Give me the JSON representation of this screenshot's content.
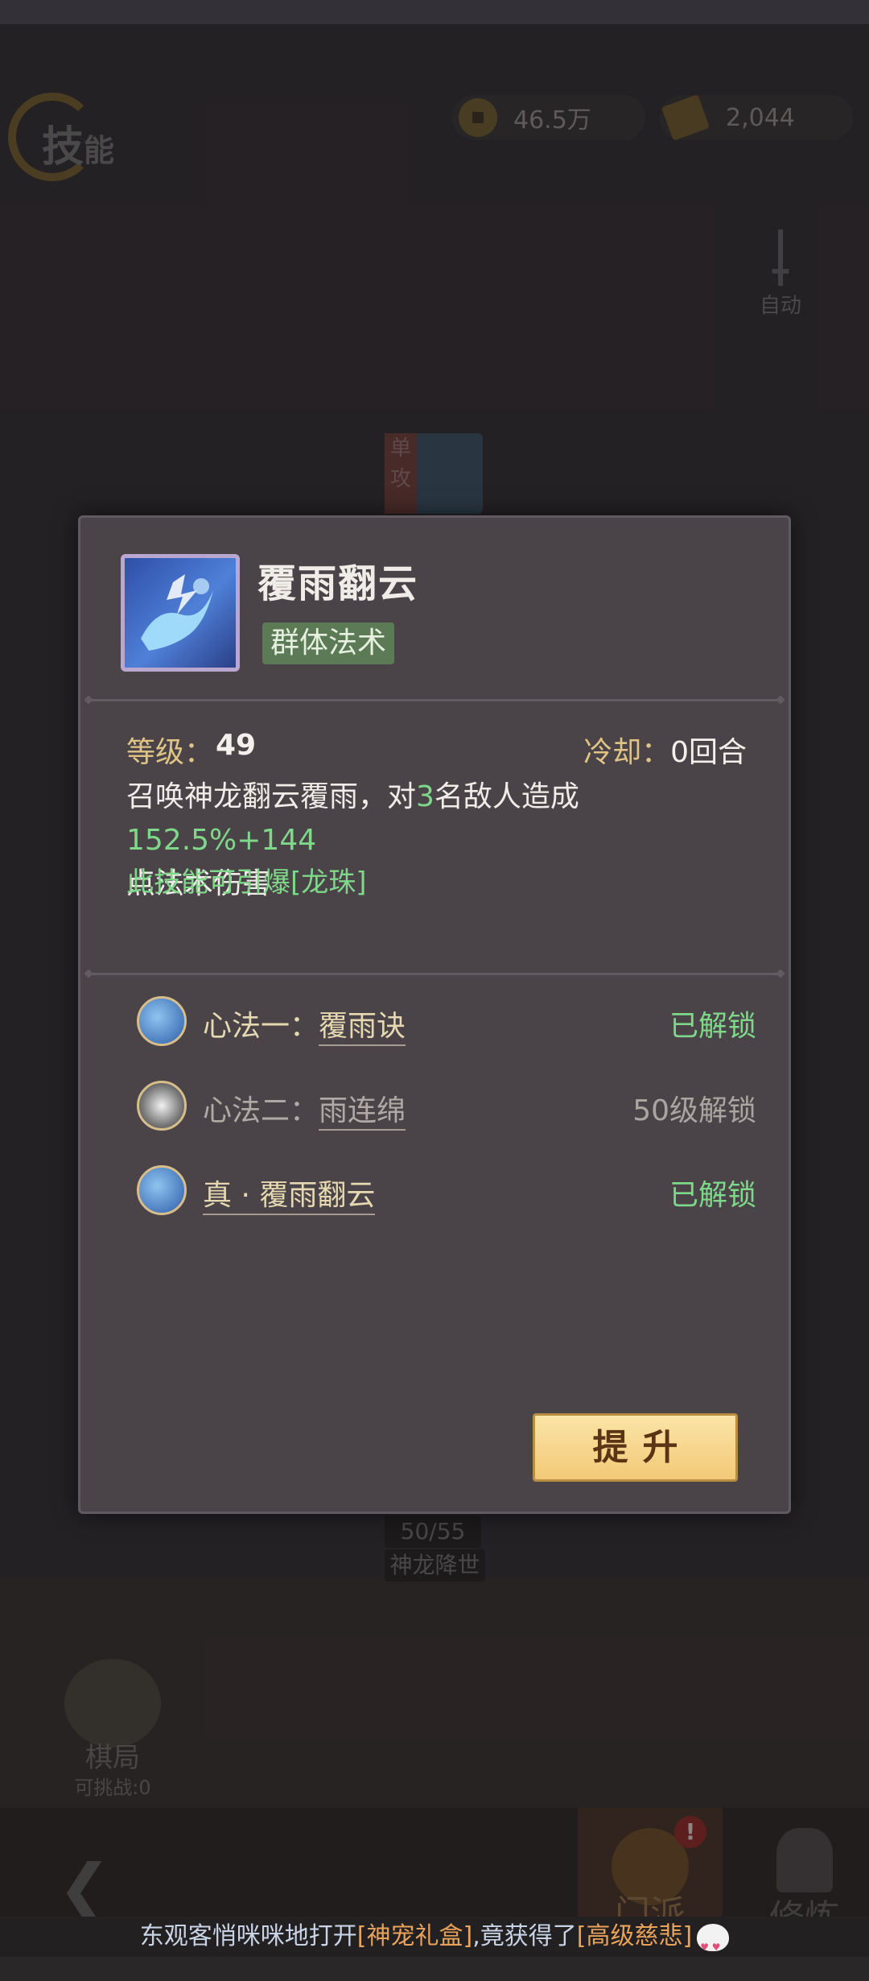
{
  "header": {
    "title_main": "技",
    "title_sub": "能",
    "currency": [
      {
        "icon": "coin-icon",
        "value": "46.5万"
      },
      {
        "icon": "scroll-icon",
        "value": "2,044"
      }
    ],
    "auto_label": "自动"
  },
  "background": {
    "skill_tag": "单攻",
    "skill_count": "50/55",
    "skill_name": "神龙降世",
    "chess_label": "棋局",
    "chess_sub": "可挑战:0",
    "back_icon": "back-arrow-icon",
    "menpai_label": "门派",
    "menpai_alert": "!",
    "xiulian_label": "修炼"
  },
  "modal": {
    "skill_name": "覆雨翻云",
    "skill_type": "群体法术",
    "level_label": "等级：",
    "level_value": "49",
    "cooldown_label": "冷却：",
    "cooldown_value": "0回合",
    "desc_1": "召唤神龙翻云覆雨，对",
    "desc_targets": "3",
    "desc_2": "名敌人造成",
    "desc_damage": "152.5%+144",
    "desc_3": "点法术伤害",
    "detonate": "此技能可引爆[龙珠]",
    "rows": [
      {
        "prefix": "心法一：",
        "name": "覆雨诀",
        "status": "已解锁"
      },
      {
        "prefix": "心法二：",
        "name": "雨连绵",
        "status": "50级解锁"
      },
      {
        "prefix": "",
        "name": "真 · 覆雨翻云",
        "status": "已解锁"
      }
    ],
    "upgrade_label": "提升"
  },
  "ticker": {
    "text_1": "东观客悄咪咪地打开",
    "item_1": "[神宠礼盒]",
    "text_2": ",竟获得了",
    "item_2": "[高级慈悲]"
  },
  "colors": {
    "accent_green": "#7fd78a",
    "label_gold": "#e0c486",
    "button_gold": "#f2c978"
  }
}
